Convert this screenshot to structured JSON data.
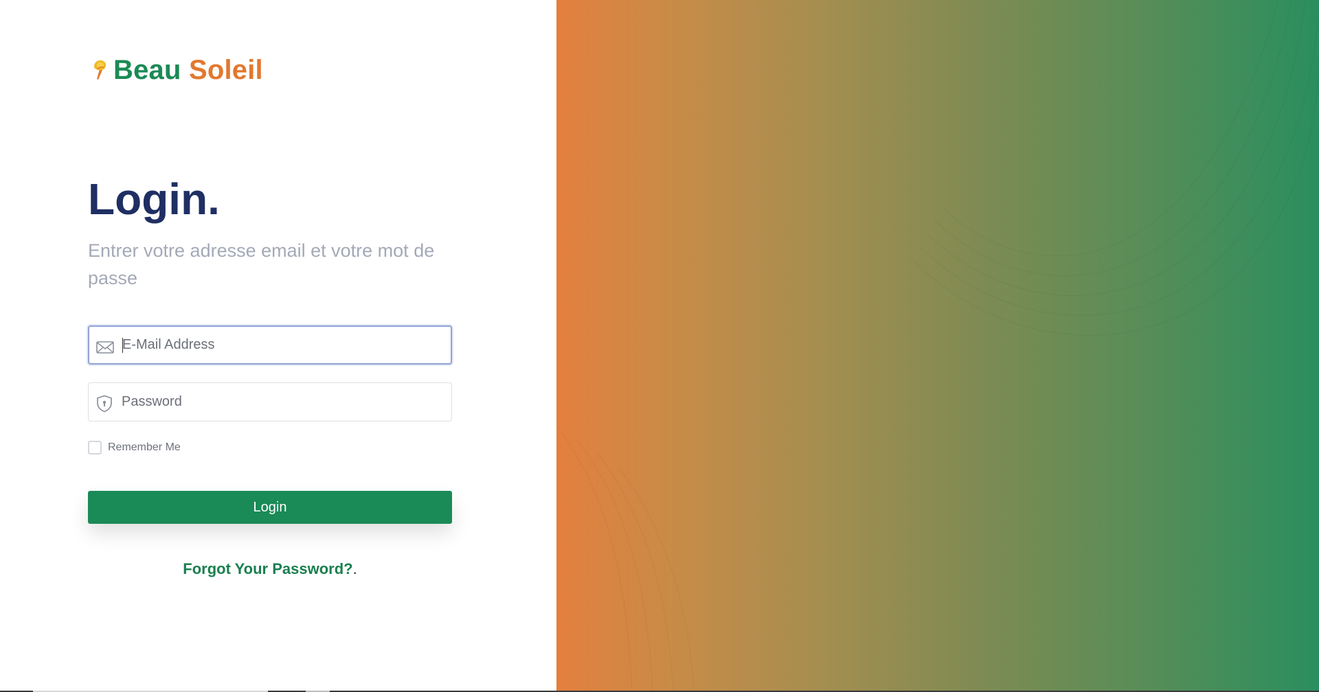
{
  "brand": {
    "name_first": "Beau",
    "name_second": "Soleil",
    "logo_icon": "torch-flame-icon",
    "colors": {
      "primary": "#1b8a55",
      "secondary": "#e2782f"
    }
  },
  "login": {
    "title": "Login.",
    "subtitle": "Entrer votre adresse email et votre mot de passe",
    "email": {
      "placeholder": "E-Mail Address",
      "value": "",
      "icon": "envelope-icon"
    },
    "password": {
      "placeholder": "Password",
      "value": "",
      "icon": "shield-lock-icon"
    },
    "remember_label": "Remember Me",
    "remember_checked": false,
    "submit_label": "Login",
    "forgot_label": "Forgot Your Password?",
    "forgot_suffix": "."
  },
  "theme": {
    "title_color": "#1f2f63",
    "button_color": "#1a8a57",
    "gradient_start": "#e47f3e",
    "gradient_end": "#2a8e5f"
  }
}
